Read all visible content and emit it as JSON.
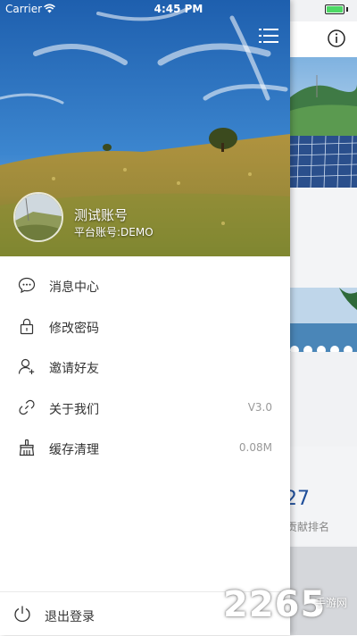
{
  "status_bar": {
    "carrier": "Carrier",
    "time": "4:45 PM"
  },
  "drawer": {
    "user_name": "测试账号",
    "platform_account": "平台账号:DEMO",
    "menu": [
      {
        "label": "消息中心",
        "icon": "message-icon",
        "value": ""
      },
      {
        "label": "修改密码",
        "icon": "lock-icon",
        "value": ""
      },
      {
        "label": "邀请好友",
        "icon": "add-user-icon",
        "value": ""
      },
      {
        "label": "关于我们",
        "icon": "link-icon",
        "value": "V3.0"
      },
      {
        "label": "缓存清理",
        "icon": "broom-icon",
        "value": "0.08M"
      }
    ],
    "logout_label": "退出登录"
  },
  "background_app": {
    "stat_number": "27",
    "stat_label": "贡献排名"
  },
  "watermark": {
    "number": "2265",
    "suffix": "手游网"
  },
  "colors": {
    "accent": "#1f4e9a",
    "battery": "#4cd964",
    "text": "#333333",
    "muted": "#999999"
  }
}
